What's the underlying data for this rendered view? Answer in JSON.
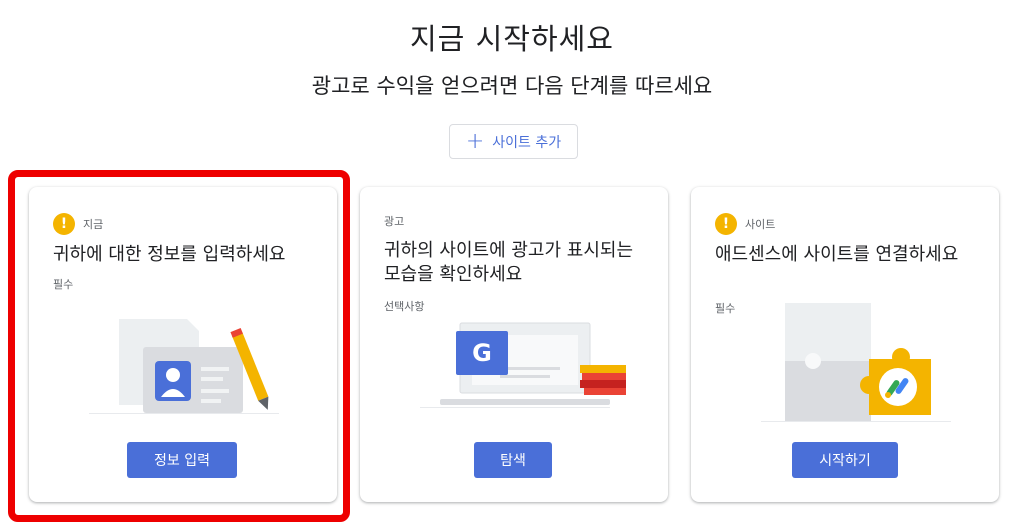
{
  "header": {
    "title": "지금 시작하세요",
    "subtitle": "광고로 수익을 얻으려면 다음 단계를 따르세요",
    "add_site_label": "사이트 추가"
  },
  "cards": [
    {
      "tag": "지금",
      "title": "귀하에 대한 정보를 입력하세요",
      "requirement": "필수",
      "button": "정보 입력",
      "warning": true
    },
    {
      "tag": "광고",
      "title": "귀하의 사이트에 광고가 표시되는 모습을 확인하세요",
      "requirement": "선택사항",
      "button": "탐색",
      "warning": false
    },
    {
      "tag": "사이트",
      "title": "애드센스에 사이트를 연결하세요",
      "requirement": "필수",
      "button": "시작하기",
      "warning": true
    }
  ],
  "illustration_text": {
    "google_letter": "G"
  },
  "colors": {
    "accent": "#4a6fd8",
    "warning": "#f4b400",
    "highlight": "#ee0000"
  }
}
